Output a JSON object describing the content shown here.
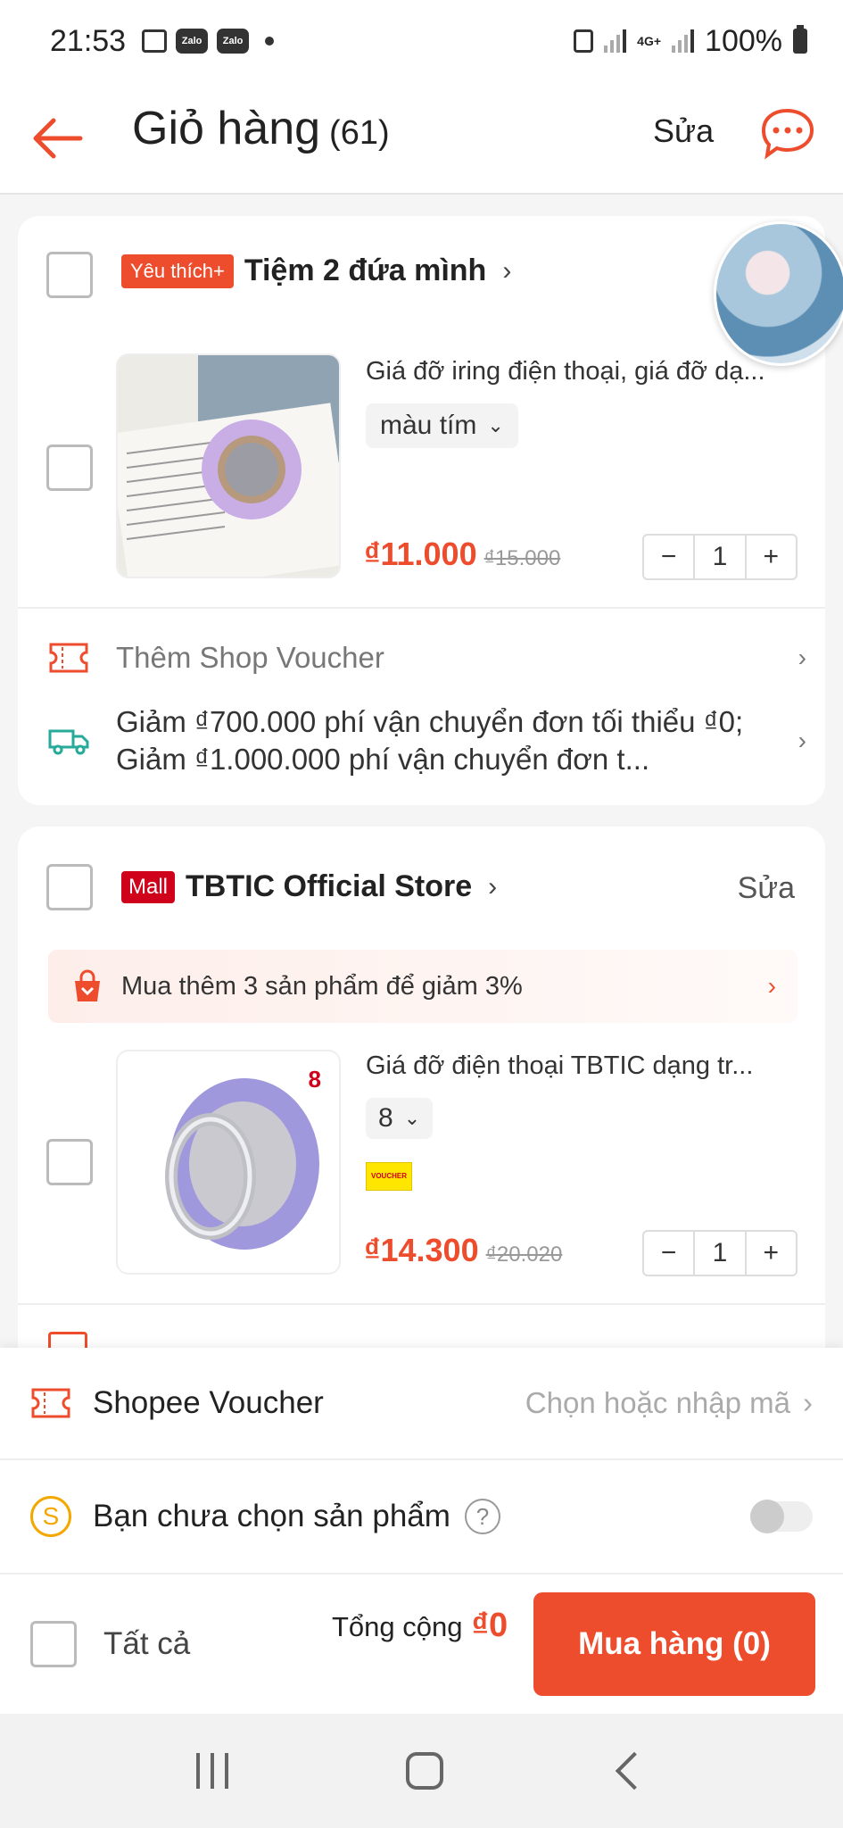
{
  "status_bar": {
    "time": "21:53",
    "app_badge_1": "Zalo",
    "app_badge_2": "Zalo",
    "network": "4G+",
    "battery": "100%"
  },
  "header": {
    "title": "Giỏ hàng",
    "count": "(61)",
    "edit": "Sửa"
  },
  "shop1": {
    "badge": "Yêu thích+",
    "name": "Tiệm 2 đứa mình",
    "product": {
      "name": "Giá đỡ iring điện thoại, giá đỡ dạ...",
      "variant": "màu tím",
      "price": "₫11.000",
      "old_price": "₫15.000",
      "qty": "1"
    },
    "voucher_label": "Thêm Shop Voucher",
    "shipping_text": "Giảm ₫700.000 phí vận chuyển đơn tối thiểu ₫0; Giảm ₫1.000.000 phí vận chuyển đơn t..."
  },
  "shop2": {
    "badge": "Mall",
    "name": "TBTIC Official Store",
    "edit": "Sửa",
    "promo": "Mua thêm 3 sản phẩm để giảm 3%",
    "product": {
      "name": "Giá đỡ điện thoại TBTIC dạng tr...",
      "variant": "8",
      "rank": "8",
      "voucher_tag": "VOUCHER",
      "price": "₫14.300",
      "old_price": "₫20.020",
      "qty": "1"
    }
  },
  "bottom": {
    "voucher_label": "Shopee Voucher",
    "voucher_action": "Chọn hoặc nhập mã",
    "coin_label": "Bạn chưa chọn sản phẩm",
    "select_all": "Tất cả",
    "total_label": "Tổng cộng",
    "total_value": "₫0",
    "buy_button": "Mua hàng (0)"
  },
  "colors": {
    "accent": "#ee4d2d",
    "mall": "#d0011b",
    "coin": "#f2a800",
    "shipping_icon": "#26aa99"
  }
}
